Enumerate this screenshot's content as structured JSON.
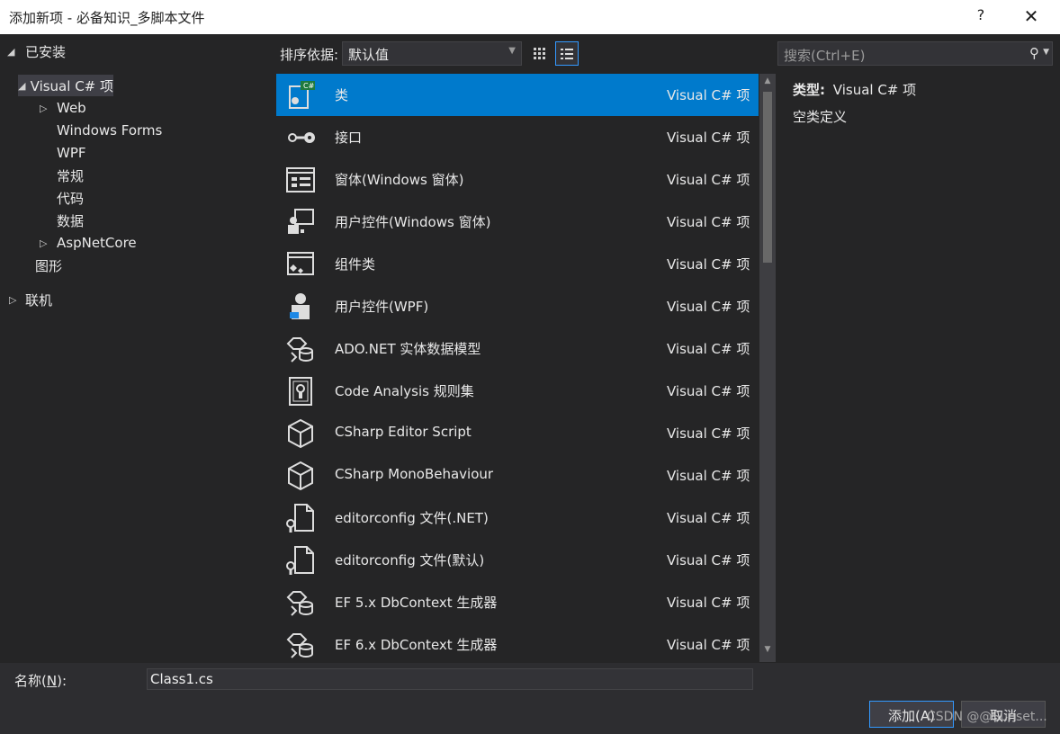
{
  "window": {
    "title": "添加新项 - 必备知识_多脚本文件",
    "help_label": "?",
    "close_label": "✕"
  },
  "tree": {
    "installed_label": "已安装",
    "items": [
      {
        "label": "Visual C# 项"
      },
      {
        "label": "Web"
      },
      {
        "label": "Windows Forms"
      },
      {
        "label": "WPF"
      },
      {
        "label": "常规"
      },
      {
        "label": "代码"
      },
      {
        "label": "数据"
      },
      {
        "label": "AspNetCore"
      },
      {
        "label": "图形"
      },
      {
        "label": "联机"
      }
    ]
  },
  "toolbar": {
    "sort_label": "排序依据:",
    "sort_value": "默认值"
  },
  "search": {
    "placeholder": "搜索(Ctrl+E)"
  },
  "templates": [
    {
      "name": "类",
      "kind": "Visual C# 项",
      "icon": "class-icon"
    },
    {
      "name": "接口",
      "kind": "Visual C# 项",
      "icon": "interface-icon"
    },
    {
      "name": "窗体(Windows 窗体)",
      "kind": "Visual C# 项",
      "icon": "form-icon"
    },
    {
      "name": "用户控件(Windows 窗体)",
      "kind": "Visual C# 项",
      "icon": "user-control-icon"
    },
    {
      "name": "组件类",
      "kind": "Visual C# 项",
      "icon": "component-icon"
    },
    {
      "name": "用户控件(WPF)",
      "kind": "Visual C# 项",
      "icon": "wpf-user-control-icon"
    },
    {
      "name": "ADO.NET 实体数据模型",
      "kind": "Visual C# 项",
      "icon": "entity-model-icon"
    },
    {
      "name": "Code Analysis 规则集",
      "kind": "Visual C# 项",
      "icon": "ruleset-icon"
    },
    {
      "name": "CSharp Editor Script",
      "kind": "Visual C# 项",
      "icon": "cube-icon"
    },
    {
      "name": "CSharp MonoBehaviour",
      "kind": "Visual C# 项",
      "icon": "cube-icon"
    },
    {
      "name": "editorconfig 文件(.NET)",
      "kind": "Visual C# 项",
      "icon": "config-file-icon"
    },
    {
      "name": "editorconfig 文件(默认)",
      "kind": "Visual C# 项",
      "icon": "config-file-icon"
    },
    {
      "name": "EF 5.x DbContext 生成器",
      "kind": "Visual C# 项",
      "icon": "entity-model-icon"
    },
    {
      "name": "EF 6.x DbContext 生成器",
      "kind": "Visual C# 项",
      "icon": "entity-model-icon"
    }
  ],
  "details": {
    "type_label": "类型:",
    "type_value": "Visual C# 项",
    "description": "空类定义"
  },
  "name_field": {
    "label_prefix": "名称(",
    "label_key": "N",
    "label_suffix": "):",
    "value": "Class1.cs"
  },
  "buttons": {
    "add": "添加(A)",
    "cancel": "取消"
  },
  "watermark": "CSDN @@Sunset..."
}
